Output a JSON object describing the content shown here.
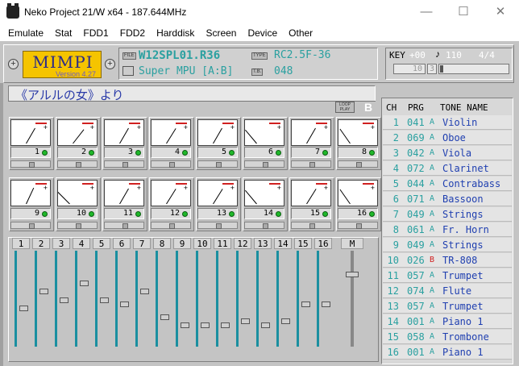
{
  "window": {
    "title": "Neko Project 21/W x64 - 187.644MHz",
    "minimize": "—",
    "maximize": "☐",
    "close": "✕"
  },
  "menu": [
    "Emulate",
    "Stat",
    "FDD1",
    "FDD2",
    "Harddisk",
    "Screen",
    "Device",
    "Other"
  ],
  "mimpi": {
    "logo": "MIMPI",
    "version": "Version 4.27"
  },
  "file": {
    "tag": "FILE",
    "name": "W12SPL01.R36",
    "device": "Super MPU [A:B]"
  },
  "type": {
    "tag": "TYPE",
    "value": "RC2.5F-36",
    "tag2": "T.B.",
    "value2": "048"
  },
  "key": {
    "label": "KEY",
    "value": "+00",
    "beat": "4/4",
    "note_icon": "♪",
    "tempo": "110",
    "bar": "10",
    "beat_pos": "3"
  },
  "song": {
    "title": "《アルルの女》より"
  },
  "loop_tag": "LOOP PLAY",
  "part_letter": "B",
  "meter_angles": [
    30,
    38,
    30,
    32,
    30,
    -40,
    30,
    -35,
    25,
    -45,
    30,
    32,
    32,
    -40,
    32,
    -35
  ],
  "channels": [
    "1",
    "2",
    "3",
    "4",
    "5",
    "6",
    "7",
    "8",
    "9",
    "10",
    "11",
    "12",
    "13",
    "14",
    "15",
    "16"
  ],
  "mixer": {
    "headers": [
      "1",
      "2",
      "3",
      "4",
      "5",
      "6",
      "7",
      "8",
      "9",
      "10",
      "11",
      "12",
      "13",
      "14",
      "15",
      "16"
    ],
    "master": "M",
    "levels": [
      0.35,
      0.55,
      0.45,
      0.65,
      0.45,
      0.4,
      0.55,
      0.25,
      0.15,
      0.15,
      0.15,
      0.2,
      0.15,
      0.2,
      0.4,
      0.4
    ],
    "master_level": 0.75
  },
  "right_panel": {
    "headers": {
      "ch": "CH",
      "prg": "PRG",
      "tone": "TONE NAME"
    },
    "rows": [
      {
        "ch": "1",
        "prg": "041",
        "bank": "A",
        "tone": "Violin"
      },
      {
        "ch": "2",
        "prg": "069",
        "bank": "A",
        "tone": "Oboe"
      },
      {
        "ch": "3",
        "prg": "042",
        "bank": "A",
        "tone": "Viola"
      },
      {
        "ch": "4",
        "prg": "072",
        "bank": "A",
        "tone": "Clarinet"
      },
      {
        "ch": "5",
        "prg": "044",
        "bank": "A",
        "tone": "Contrabass"
      },
      {
        "ch": "6",
        "prg": "071",
        "bank": "A",
        "tone": "Bassoon"
      },
      {
        "ch": "7",
        "prg": "049",
        "bank": "A",
        "tone": "Strings"
      },
      {
        "ch": "8",
        "prg": "061",
        "bank": "A",
        "tone": "Fr. Horn"
      },
      {
        "ch": "9",
        "prg": "049",
        "bank": "A",
        "tone": "Strings"
      },
      {
        "ch": "10",
        "prg": "026",
        "bank": "B",
        "tone": "TR-808"
      },
      {
        "ch": "11",
        "prg": "057",
        "bank": "A",
        "tone": "Trumpet"
      },
      {
        "ch": "12",
        "prg": "074",
        "bank": "A",
        "tone": "Flute"
      },
      {
        "ch": "13",
        "prg": "057",
        "bank": "A",
        "tone": "Trumpet"
      },
      {
        "ch": "14",
        "prg": "001",
        "bank": "A",
        "tone": "Piano 1"
      },
      {
        "ch": "15",
        "prg": "058",
        "bank": "A",
        "tone": "Trombone"
      },
      {
        "ch": "16",
        "prg": "001",
        "bank": "A",
        "tone": "Piano 1"
      }
    ]
  },
  "colors": {
    "lcd": "#2aa0a0",
    "tone": "#1f3fb0",
    "title": "#2a3aa8",
    "mixer_track": "#1a8fa0",
    "led": "#1fb82a",
    "rhythm_bank": "#d02020"
  }
}
